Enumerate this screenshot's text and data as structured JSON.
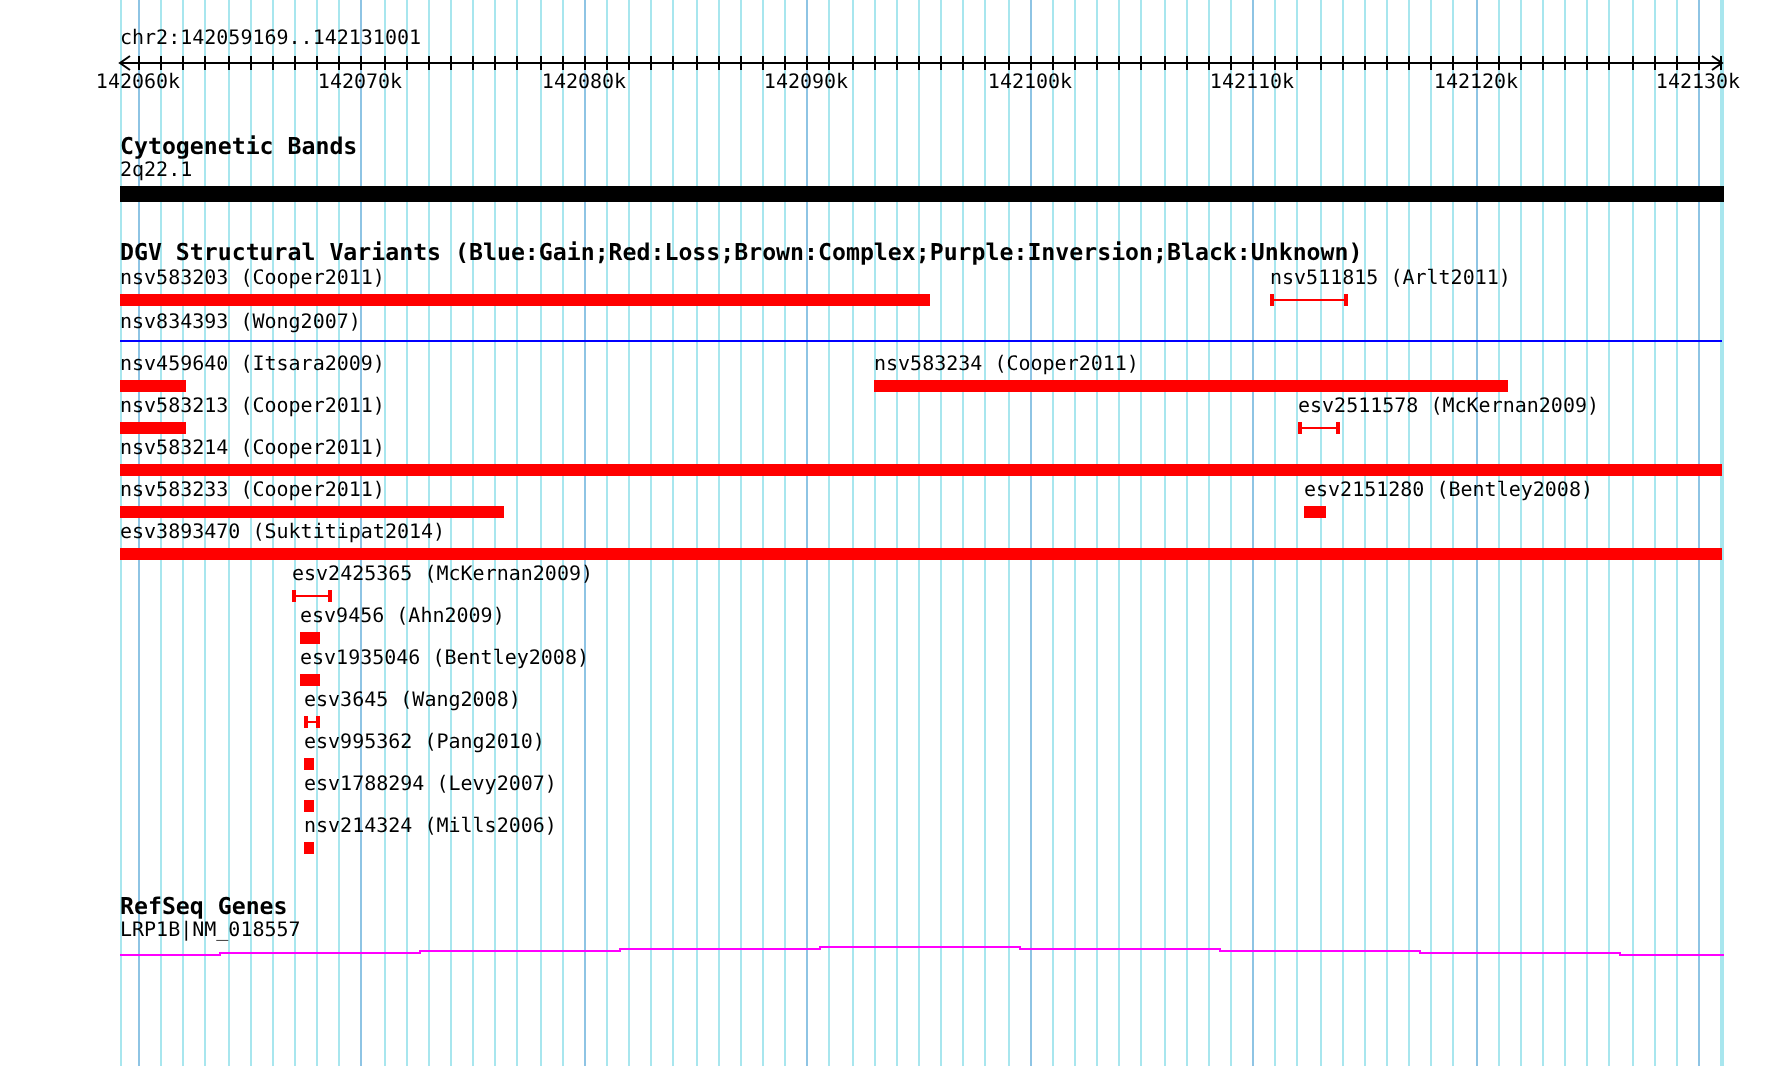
{
  "ruler": {
    "region": "chr2:142059169..142131001",
    "ticks": [
      "142060k",
      "142070k",
      "142080k",
      "142090k",
      "142100k",
      "142110k",
      "142120k",
      "142130k"
    ]
  },
  "tracks": [
    {
      "kind": "bands",
      "title": "Cytogenetic Bands",
      "features": [
        {
          "label": "2q22.1",
          "color": "#000000"
        }
      ]
    },
    {
      "kind": "variants",
      "title": "DGV Structural Variants (Blue:Gain;Red:Loss;Brown:Complex;Purple:Inversion;Black:Unknown)",
      "features": [
        {
          "label": "nsv583203 (Cooper2011)",
          "kind": "bar",
          "color": "#ff0000"
        },
        {
          "label": "nsv511815 (Arlt2011)",
          "kind": "whisker",
          "color": "#ff0000"
        },
        {
          "label": "nsv834393 (Wong2007)",
          "kind": "line",
          "color": "#0000ff"
        },
        {
          "label": "nsv459640 (Itsara2009)",
          "kind": "bar",
          "color": "#ff0000"
        },
        {
          "label": "nsv583234 (Cooper2011)",
          "kind": "bar",
          "color": "#ff0000"
        },
        {
          "label": "nsv583213 (Cooper2011)",
          "kind": "bar",
          "color": "#ff0000"
        },
        {
          "label": "esv2511578 (McKernan2009)",
          "kind": "whisker",
          "color": "#ff0000"
        },
        {
          "label": "nsv583214 (Cooper2011)",
          "kind": "bar",
          "color": "#ff0000"
        },
        {
          "label": "nsv583233 (Cooper2011)",
          "kind": "bar",
          "color": "#ff0000"
        },
        {
          "label": "esv2151280 (Bentley2008)",
          "kind": "bar",
          "color": "#ff0000"
        },
        {
          "label": "esv3893470 (Suktitipat2014)",
          "kind": "bar",
          "color": "#ff0000"
        },
        {
          "label": "esv2425365 (McKernan2009)",
          "kind": "whisker",
          "color": "#ff0000"
        },
        {
          "label": "esv9456 (Ahn2009)",
          "kind": "bar",
          "color": "#ff0000"
        },
        {
          "label": "esv1935046 (Bentley2008)",
          "kind": "bar",
          "color": "#ff0000"
        },
        {
          "label": "esv3645 (Wang2008)",
          "kind": "whisker",
          "color": "#ff0000"
        },
        {
          "label": "esv995362 (Pang2010)",
          "kind": "bar",
          "color": "#ff0000"
        },
        {
          "label": "esv1788294 (Levy2007)",
          "kind": "bar",
          "color": "#ff0000"
        },
        {
          "label": "nsv214324 (Mills2006)",
          "kind": "bar",
          "color": "#ff0000"
        }
      ]
    },
    {
      "kind": "genes",
      "title": "RefSeq Genes",
      "features": [
        {
          "label": "LRP1B|NM_018557",
          "color": "#ff00ff"
        }
      ]
    }
  ]
}
